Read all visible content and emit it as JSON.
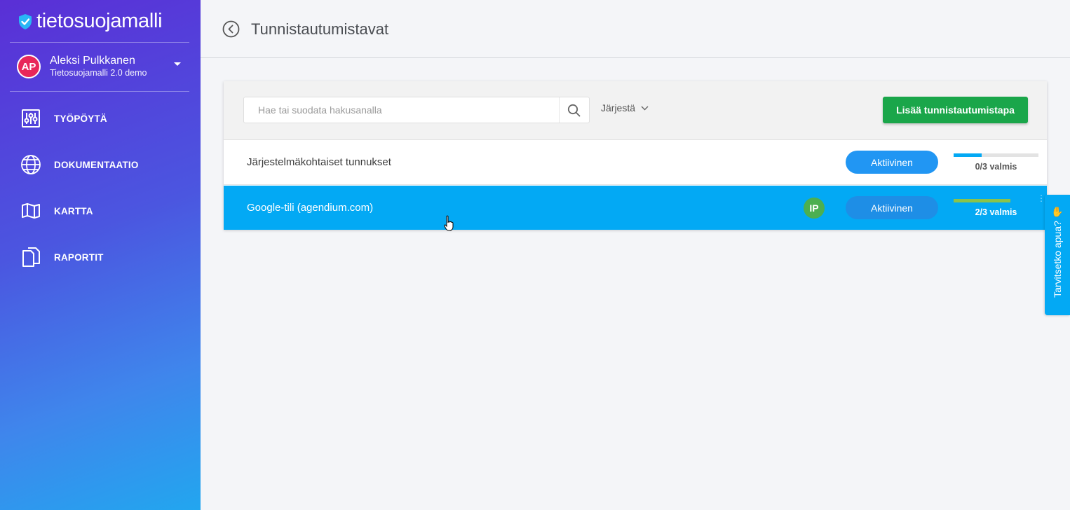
{
  "app": {
    "logo_text": "tietosuojamalli"
  },
  "user": {
    "initials": "AP",
    "name": "Aleksi Pulkkanen",
    "organization": "Tietosuojamalli 2.0 demo"
  },
  "sidebar": {
    "items": [
      {
        "label": "TYÖPÖYTÄ",
        "icon": "sliders-icon"
      },
      {
        "label": "DOKUMENTAATIO",
        "icon": "globe-icon"
      },
      {
        "label": "KARTTA",
        "icon": "map-icon"
      },
      {
        "label": "RAPORTIT",
        "icon": "documents-icon"
      }
    ]
  },
  "header": {
    "title": "Tunnistautumistavat"
  },
  "toolbar": {
    "search_placeholder": "Hae tai suodata hakusanalla",
    "sort_label": "Järjestä",
    "add_button": "Lisää tunnistautumistapa"
  },
  "rows": [
    {
      "title": "Järjestelmäkohtaiset tunnukset",
      "status": "Aktiivinen",
      "progress_text": "0/3 valmis",
      "progress": 0.33,
      "badge": ""
    },
    {
      "title": "Google-tili (agendium.com)",
      "status": "Aktiivinen",
      "progress_text": "2/3 valmis",
      "progress": 0.67,
      "badge": "IP"
    }
  ],
  "help": {
    "label": "Tarvitsetko apua?"
  },
  "colors": {
    "accent": "#03a9f4",
    "add_button": "#1aa64a",
    "avatar": "#e8275a",
    "badge": "#4caf50"
  }
}
